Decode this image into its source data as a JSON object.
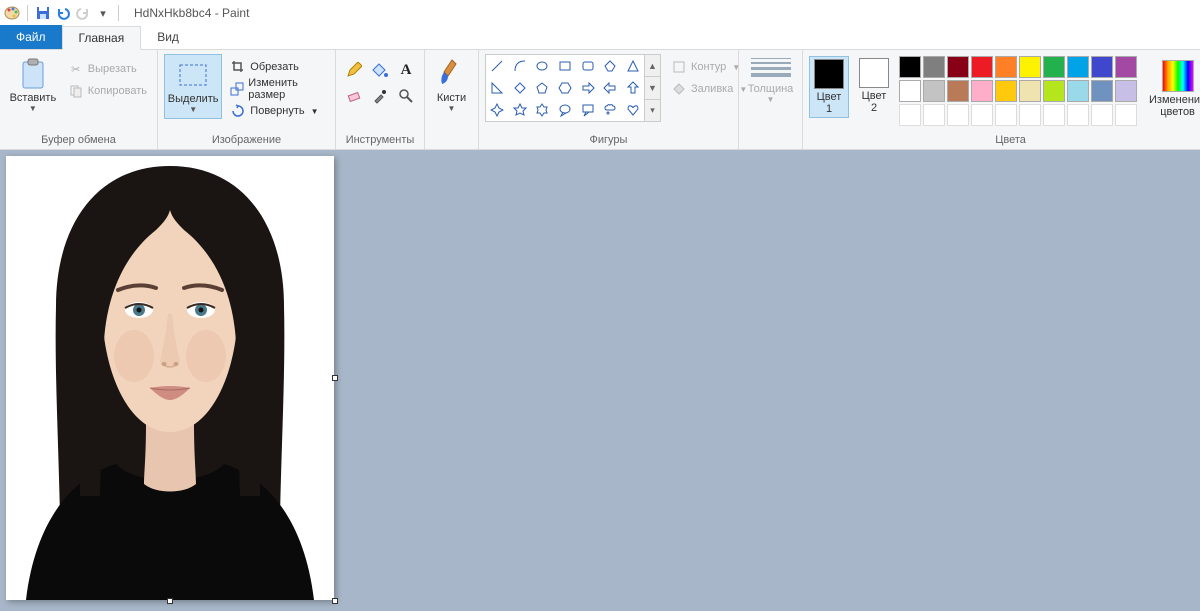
{
  "title": {
    "doc": "HdNxHkb8bc4",
    "app": "Paint"
  },
  "tabs": {
    "file": "Файл",
    "home": "Главная",
    "view": "Вид"
  },
  "groups": {
    "clipboard": {
      "label": "Буфер обмена",
      "paste": "Вставить",
      "cut": "Вырезать",
      "copy": "Копировать"
    },
    "image": {
      "label": "Изображение",
      "select": "Выделить",
      "crop": "Обрезать",
      "resize": "Изменить размер",
      "rotate": "Повернуть"
    },
    "tools": {
      "label": "Инструменты"
    },
    "brushes": {
      "label": "Кисти"
    },
    "shapes": {
      "label": "Фигуры",
      "outline": "Контур",
      "fill": "Заливка"
    },
    "size": {
      "label": "Толщина"
    },
    "colors": {
      "label": "Цвета",
      "color1": "Цвет\n1",
      "color2": "Цвет\n2",
      "edit": "Изменение\nцветов"
    }
  },
  "palette_row1": [
    "#000000",
    "#7f7f7f",
    "#880015",
    "#ed1c24",
    "#ff7f27",
    "#fff200",
    "#22b14c",
    "#00a2e8",
    "#3f48cc",
    "#a349a4"
  ],
  "palette_row2": [
    "#ffffff",
    "#c3c3c3",
    "#b97a57",
    "#ffaec9",
    "#ffc90e",
    "#efe4b0",
    "#b5e61d",
    "#99d9ea",
    "#7092be",
    "#c8bfe7"
  ],
  "color1_value": "#000000",
  "color2_value": "#ffffff"
}
